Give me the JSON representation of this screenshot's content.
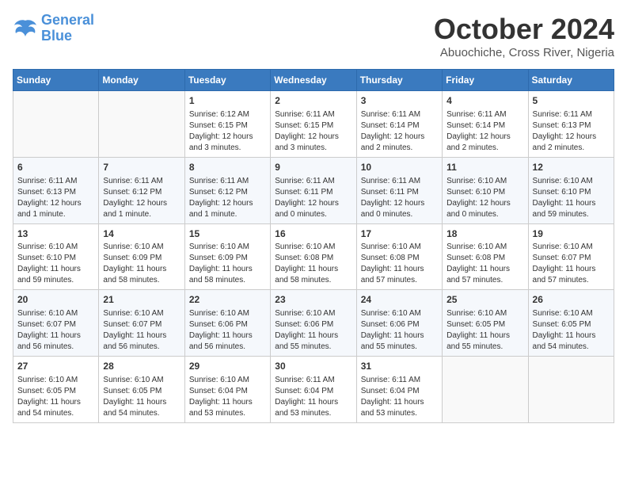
{
  "logo": {
    "line1": "General",
    "line2": "Blue"
  },
  "title": "October 2024",
  "location": "Abuochiche, Cross River, Nigeria",
  "days_of_week": [
    "Sunday",
    "Monday",
    "Tuesday",
    "Wednesday",
    "Thursday",
    "Friday",
    "Saturday"
  ],
  "weeks": [
    [
      {
        "day": "",
        "info": ""
      },
      {
        "day": "",
        "info": ""
      },
      {
        "day": "1",
        "info": "Sunrise: 6:12 AM\nSunset: 6:15 PM\nDaylight: 12 hours and 3 minutes."
      },
      {
        "day": "2",
        "info": "Sunrise: 6:11 AM\nSunset: 6:15 PM\nDaylight: 12 hours and 3 minutes."
      },
      {
        "day": "3",
        "info": "Sunrise: 6:11 AM\nSunset: 6:14 PM\nDaylight: 12 hours and 2 minutes."
      },
      {
        "day": "4",
        "info": "Sunrise: 6:11 AM\nSunset: 6:14 PM\nDaylight: 12 hours and 2 minutes."
      },
      {
        "day": "5",
        "info": "Sunrise: 6:11 AM\nSunset: 6:13 PM\nDaylight: 12 hours and 2 minutes."
      }
    ],
    [
      {
        "day": "6",
        "info": "Sunrise: 6:11 AM\nSunset: 6:13 PM\nDaylight: 12 hours and 1 minute."
      },
      {
        "day": "7",
        "info": "Sunrise: 6:11 AM\nSunset: 6:12 PM\nDaylight: 12 hours and 1 minute."
      },
      {
        "day": "8",
        "info": "Sunrise: 6:11 AM\nSunset: 6:12 PM\nDaylight: 12 hours and 1 minute."
      },
      {
        "day": "9",
        "info": "Sunrise: 6:11 AM\nSunset: 6:11 PM\nDaylight: 12 hours and 0 minutes."
      },
      {
        "day": "10",
        "info": "Sunrise: 6:11 AM\nSunset: 6:11 PM\nDaylight: 12 hours and 0 minutes."
      },
      {
        "day": "11",
        "info": "Sunrise: 6:10 AM\nSunset: 6:10 PM\nDaylight: 12 hours and 0 minutes."
      },
      {
        "day": "12",
        "info": "Sunrise: 6:10 AM\nSunset: 6:10 PM\nDaylight: 11 hours and 59 minutes."
      }
    ],
    [
      {
        "day": "13",
        "info": "Sunrise: 6:10 AM\nSunset: 6:10 PM\nDaylight: 11 hours and 59 minutes."
      },
      {
        "day": "14",
        "info": "Sunrise: 6:10 AM\nSunset: 6:09 PM\nDaylight: 11 hours and 58 minutes."
      },
      {
        "day": "15",
        "info": "Sunrise: 6:10 AM\nSunset: 6:09 PM\nDaylight: 11 hours and 58 minutes."
      },
      {
        "day": "16",
        "info": "Sunrise: 6:10 AM\nSunset: 6:08 PM\nDaylight: 11 hours and 58 minutes."
      },
      {
        "day": "17",
        "info": "Sunrise: 6:10 AM\nSunset: 6:08 PM\nDaylight: 11 hours and 57 minutes."
      },
      {
        "day": "18",
        "info": "Sunrise: 6:10 AM\nSunset: 6:08 PM\nDaylight: 11 hours and 57 minutes."
      },
      {
        "day": "19",
        "info": "Sunrise: 6:10 AM\nSunset: 6:07 PM\nDaylight: 11 hours and 57 minutes."
      }
    ],
    [
      {
        "day": "20",
        "info": "Sunrise: 6:10 AM\nSunset: 6:07 PM\nDaylight: 11 hours and 56 minutes."
      },
      {
        "day": "21",
        "info": "Sunrise: 6:10 AM\nSunset: 6:07 PM\nDaylight: 11 hours and 56 minutes."
      },
      {
        "day": "22",
        "info": "Sunrise: 6:10 AM\nSunset: 6:06 PM\nDaylight: 11 hours and 56 minutes."
      },
      {
        "day": "23",
        "info": "Sunrise: 6:10 AM\nSunset: 6:06 PM\nDaylight: 11 hours and 55 minutes."
      },
      {
        "day": "24",
        "info": "Sunrise: 6:10 AM\nSunset: 6:06 PM\nDaylight: 11 hours and 55 minutes."
      },
      {
        "day": "25",
        "info": "Sunrise: 6:10 AM\nSunset: 6:05 PM\nDaylight: 11 hours and 55 minutes."
      },
      {
        "day": "26",
        "info": "Sunrise: 6:10 AM\nSunset: 6:05 PM\nDaylight: 11 hours and 54 minutes."
      }
    ],
    [
      {
        "day": "27",
        "info": "Sunrise: 6:10 AM\nSunset: 6:05 PM\nDaylight: 11 hours and 54 minutes."
      },
      {
        "day": "28",
        "info": "Sunrise: 6:10 AM\nSunset: 6:05 PM\nDaylight: 11 hours and 54 minutes."
      },
      {
        "day": "29",
        "info": "Sunrise: 6:10 AM\nSunset: 6:04 PM\nDaylight: 11 hours and 53 minutes."
      },
      {
        "day": "30",
        "info": "Sunrise: 6:11 AM\nSunset: 6:04 PM\nDaylight: 11 hours and 53 minutes."
      },
      {
        "day": "31",
        "info": "Sunrise: 6:11 AM\nSunset: 6:04 PM\nDaylight: 11 hours and 53 minutes."
      },
      {
        "day": "",
        "info": ""
      },
      {
        "day": "",
        "info": ""
      }
    ]
  ]
}
